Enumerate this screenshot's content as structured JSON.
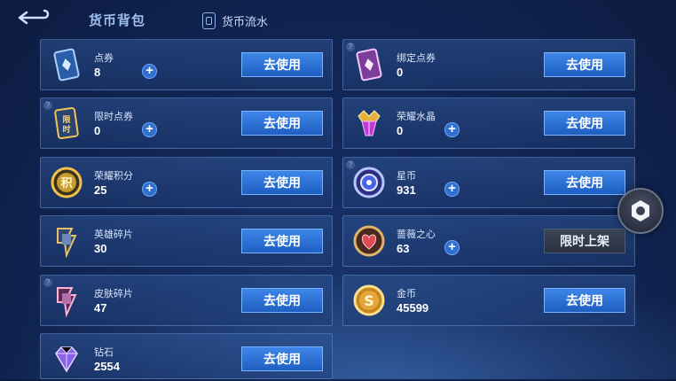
{
  "header": {
    "back_label": "",
    "title": "货币背包",
    "flow_tab": "货币流水"
  },
  "cards": [
    {
      "name": "点券",
      "amount": "8",
      "button": "去使用",
      "icon": "coupon-card-icon",
      "has_plus": true,
      "has_q": false
    },
    {
      "name": "绑定点券",
      "amount": "0",
      "button": "去使用",
      "icon": "bound-coupon-card-icon",
      "has_plus": false,
      "has_q": true
    },
    {
      "name": "限时点券",
      "amount": "0",
      "button": "去使用",
      "icon": "limited-coupon-icon",
      "has_plus": true,
      "has_q": true
    },
    {
      "name": "荣耀水晶",
      "amount": "0",
      "button": "去使用",
      "icon": "glory-crystal-icon",
      "has_plus": true,
      "has_q": false
    },
    {
      "name": "荣耀积分",
      "amount": "25",
      "button": "去使用",
      "icon": "glory-points-icon",
      "has_plus": true,
      "has_q": false
    },
    {
      "name": "星币",
      "amount": "931",
      "button": "去使用",
      "icon": "star-coin-icon",
      "has_plus": true,
      "has_q": true
    },
    {
      "name": "英雄碎片",
      "amount": "30",
      "button": "去使用",
      "icon": "hero-fragment-icon",
      "has_plus": false,
      "has_q": false
    },
    {
      "name": "蔷薇之心",
      "amount": "63",
      "button": "限时上架",
      "icon": "rose-heart-icon",
      "has_plus": true,
      "has_q": false
    },
    {
      "name": "皮肤碎片",
      "amount": "47",
      "button": "去使用",
      "icon": "skin-fragment-icon",
      "has_plus": false,
      "has_q": true
    },
    {
      "name": "金币",
      "amount": "45599",
      "button": "去使用",
      "icon": "gold-coin-icon",
      "has_plus": false,
      "has_q": false
    },
    {
      "name": "钻石",
      "amount": "2554",
      "button": "去使用",
      "icon": "diamond-icon",
      "has_plus": false,
      "has_q": false
    }
  ],
  "floating_button_icon": "hexagon-menu-icon",
  "colors": {
    "accent": "#2e6fd0",
    "button": "#3d86e8",
    "background": "#13295a"
  }
}
